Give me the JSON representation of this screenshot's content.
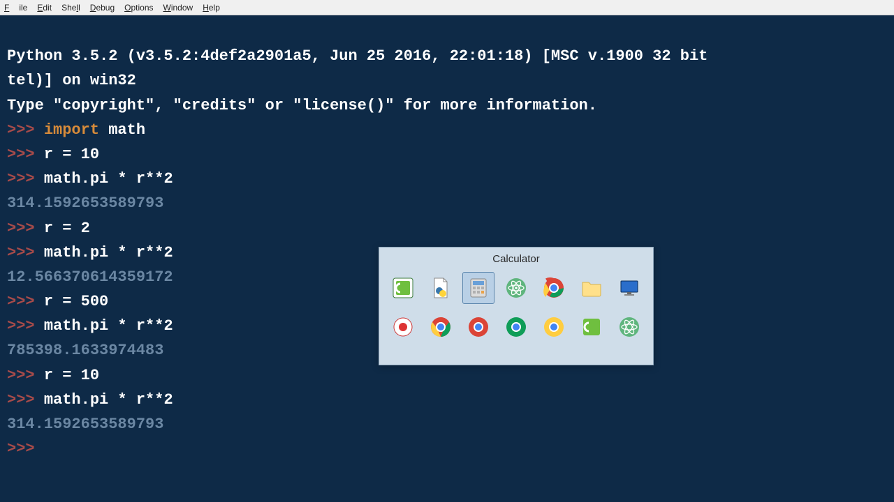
{
  "menu": {
    "file": "File",
    "edit": "Edit",
    "shell": "Shell",
    "debug": "Debug",
    "options": "Options",
    "window": "Window",
    "help": "Help"
  },
  "terminal": {
    "header1": "Python 3.5.2 (v3.5.2:4def2a2901a5, Jun 25 2016, 22:01:18) [MSC v.1900 32 bit",
    "header2": "tel)] on win32",
    "header3": "Type \"copyright\", \"credits\" or \"license()\" for more information.",
    "prompt": ">>> ",
    "kw_import": "import",
    "module": " math",
    "l_r10": "r = 10",
    "l_expr": "math.pi * r**2",
    "res1": "314.1592653589793",
    "l_r2": "r = 2",
    "res2": "12.566370614359172",
    "l_r500": "r = 500",
    "res3": "785398.1633974483",
    "res4": "314.1592653589793"
  },
  "switcher": {
    "title": "Calculator",
    "selected_index": 2,
    "items": [
      {
        "name": "camtasia-icon"
      },
      {
        "name": "python-file-icon"
      },
      {
        "name": "calculator-icon"
      },
      {
        "name": "atom-icon"
      },
      {
        "name": "chrome-icon"
      },
      {
        "name": "folder-icon"
      },
      {
        "name": "desktop-icon"
      },
      {
        "name": "recorder-icon"
      },
      {
        "name": "chrome-icon"
      },
      {
        "name": "chrome-icon"
      },
      {
        "name": "chrome-icon"
      },
      {
        "name": "chrome-icon"
      },
      {
        "name": "camtasia-icon"
      },
      {
        "name": "atom-icon"
      }
    ]
  }
}
